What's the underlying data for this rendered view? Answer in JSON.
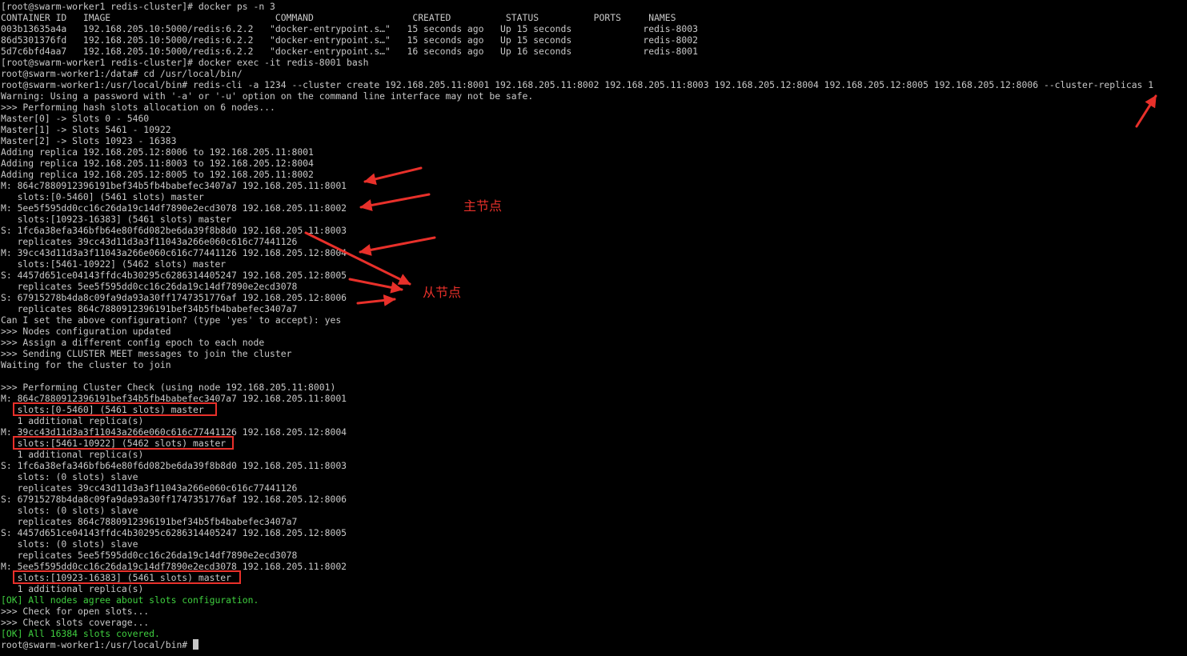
{
  "terminal": {
    "lines": [
      {
        "text": "[root@swarm-worker1 redis-cluster]# docker ps -n 3",
        "color": "normal"
      },
      {
        "text": "CONTAINER ID   IMAGE                              COMMAND                  CREATED          STATUS          PORTS     NAMES",
        "color": "normal"
      },
      {
        "text": "003b13635a4a   192.168.205.10:5000/redis:6.2.2   \"docker-entrypoint.s…\"   15 seconds ago   Up 15 seconds             redis-8003",
        "color": "normal"
      },
      {
        "text": "86d5301376fd   192.168.205.10:5000/redis:6.2.2   \"docker-entrypoint.s…\"   15 seconds ago   Up 15 seconds             redis-8002",
        "color": "normal"
      },
      {
        "text": "5d7c6bfd4aa7   192.168.205.10:5000/redis:6.2.2   \"docker-entrypoint.s…\"   16 seconds ago   Up 16 seconds             redis-8001",
        "color": "normal"
      },
      {
        "text": "[root@swarm-worker1 redis-cluster]# docker exec -it redis-8001 bash",
        "color": "normal"
      },
      {
        "text": "root@swarm-worker1:/data# cd /usr/local/bin/",
        "color": "normal"
      },
      {
        "text": "root@swarm-worker1:/usr/local/bin# redis-cli -a 1234 --cluster create 192.168.205.11:8001 192.168.205.11:8002 192.168.205.11:8003 192.168.205.12:8004 192.168.205.12:8005 192.168.205.12:8006 --cluster-replicas 1",
        "color": "normal"
      },
      {
        "text": "Warning: Using a password with '-a' or '-u' option on the command line interface may not be safe.",
        "color": "normal"
      },
      {
        "text": ">>> Performing hash slots allocation on 6 nodes...",
        "color": "normal"
      },
      {
        "text": "Master[0] -> Slots 0 - 5460",
        "color": "normal"
      },
      {
        "text": "Master[1] -> Slots 5461 - 10922",
        "color": "normal"
      },
      {
        "text": "Master[2] -> Slots 10923 - 16383",
        "color": "normal"
      },
      {
        "text": "Adding replica 192.168.205.12:8006 to 192.168.205.11:8001",
        "color": "normal"
      },
      {
        "text": "Adding replica 192.168.205.11:8003 to 192.168.205.12:8004",
        "color": "normal"
      },
      {
        "text": "Adding replica 192.168.205.12:8005 to 192.168.205.11:8002",
        "color": "normal"
      },
      {
        "text": "M: 864c7880912396191bef34b5fb4babefec3407a7 192.168.205.11:8001",
        "color": "normal"
      },
      {
        "text": "   slots:[0-5460] (5461 slots) master",
        "color": "normal"
      },
      {
        "text": "M: 5ee5f595dd0cc16c26da19c14df7890e2ecd3078 192.168.205.11:8002",
        "color": "normal"
      },
      {
        "text": "   slots:[10923-16383] (5461 slots) master",
        "color": "normal"
      },
      {
        "text": "S: 1fc6a38efa346bfb64e80f6d082be6da39f8b8d0 192.168.205.11:8003",
        "color": "normal"
      },
      {
        "text": "   replicates 39cc43d11d3a3f11043a266e060c616c77441126",
        "color": "normal"
      },
      {
        "text": "M: 39cc43d11d3a3f11043a266e060c616c77441126 192.168.205.12:8004",
        "color": "normal"
      },
      {
        "text": "   slots:[5461-10922] (5462 slots) master",
        "color": "normal"
      },
      {
        "text": "S: 4457d651ce04143ffdc4b30295c6286314405247 192.168.205.12:8005",
        "color": "normal"
      },
      {
        "text": "   replicates 5ee5f595dd0cc16c26da19c14df7890e2ecd3078",
        "color": "normal"
      },
      {
        "text": "S: 67915278b4da8c09fa9da93a30ff1747351776af 192.168.205.12:8006",
        "color": "normal"
      },
      {
        "text": "   replicates 864c7880912396191bef34b5fb4babefec3407a7",
        "color": "normal"
      },
      {
        "text": "Can I set the above configuration? (type 'yes' to accept): yes",
        "color": "normal"
      },
      {
        "text": ">>> Nodes configuration updated",
        "color": "normal"
      },
      {
        "text": ">>> Assign a different config epoch to each node",
        "color": "normal"
      },
      {
        "text": ">>> Sending CLUSTER MEET messages to join the cluster",
        "color": "normal"
      },
      {
        "text": "Waiting for the cluster to join",
        "color": "normal"
      },
      {
        "text": "",
        "color": "normal"
      },
      {
        "text": ">>> Performing Cluster Check (using node 192.168.205.11:8001)",
        "color": "normal"
      },
      {
        "text": "M: 864c7880912396191bef34b5fb4babefec3407a7 192.168.205.11:8001",
        "color": "normal"
      },
      {
        "text": "   slots:[0-5460] (5461 slots) master",
        "color": "normal"
      },
      {
        "text": "   1 additional replica(s)",
        "color": "normal"
      },
      {
        "text": "M: 39cc43d11d3a3f11043a266e060c616c77441126 192.168.205.12:8004",
        "color": "normal"
      },
      {
        "text": "   slots:[5461-10922] (5462 slots) master",
        "color": "normal"
      },
      {
        "text": "   1 additional replica(s)",
        "color": "normal"
      },
      {
        "text": "S: 1fc6a38efa346bfb64e80f6d082be6da39f8b8d0 192.168.205.11:8003",
        "color": "normal"
      },
      {
        "text": "   slots: (0 slots) slave",
        "color": "normal"
      },
      {
        "text": "   replicates 39cc43d11d3a3f11043a266e060c616c77441126",
        "color": "normal"
      },
      {
        "text": "S: 67915278b4da8c09fa9da93a30ff1747351776af 192.168.205.12:8006",
        "color": "normal"
      },
      {
        "text": "   slots: (0 slots) slave",
        "color": "normal"
      },
      {
        "text": "   replicates 864c7880912396191bef34b5fb4babefec3407a7",
        "color": "normal"
      },
      {
        "text": "S: 4457d651ce04143ffdc4b30295c6286314405247 192.168.205.12:8005",
        "color": "normal"
      },
      {
        "text": "   slots: (0 slots) slave",
        "color": "normal"
      },
      {
        "text": "   replicates 5ee5f595dd0cc16c26da19c14df7890e2ecd3078",
        "color": "normal"
      },
      {
        "text": "M: 5ee5f595dd0cc16c26da19c14df7890e2ecd3078 192.168.205.11:8002",
        "color": "normal"
      },
      {
        "text": "   slots:[10923-16383] (5461 slots) master",
        "color": "normal"
      },
      {
        "text": "   1 additional replica(s)",
        "color": "normal"
      },
      {
        "text": "[OK] All nodes agree about slots configuration.",
        "color": "green"
      },
      {
        "text": ">>> Check for open slots...",
        "color": "normal"
      },
      {
        "text": ">>> Check slots coverage...",
        "color": "normal"
      },
      {
        "text": "[OK] All 16384 slots covered.",
        "color": "green"
      },
      {
        "text": "root@swarm-worker1:/usr/local/bin# ",
        "color": "normal"
      }
    ]
  },
  "annotations": {
    "master_label": "主节点",
    "replica_label": "从节点",
    "color": "#e8302a"
  },
  "colors": {
    "background": "#000000",
    "text": "#c8c8c8",
    "ok_green": "#3fcf3f"
  }
}
